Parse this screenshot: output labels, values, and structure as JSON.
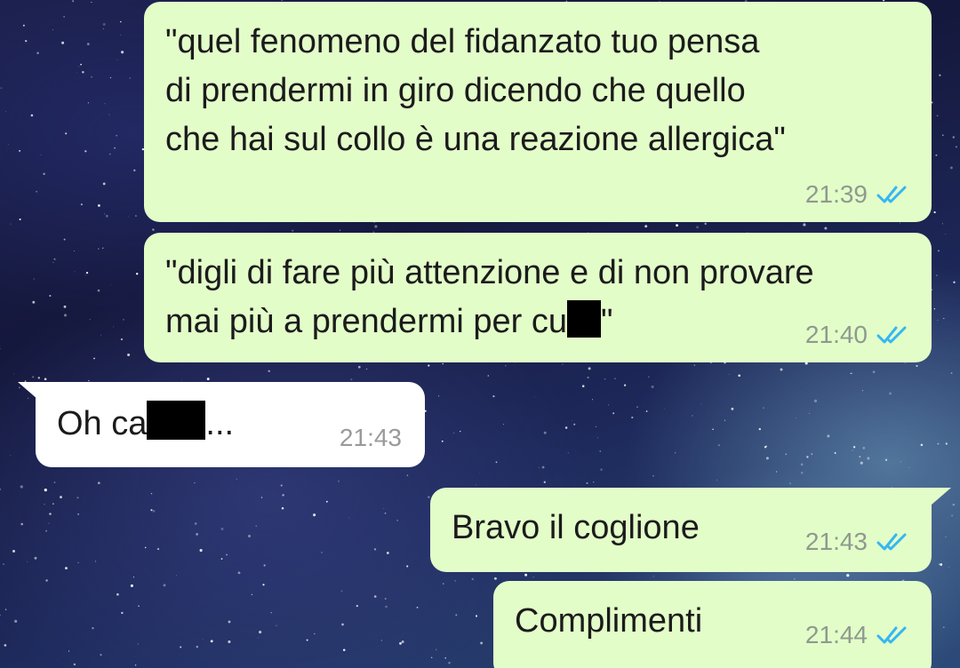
{
  "messages": [
    {
      "direction": "sent",
      "lines": [
        "\"quel fenomeno del fidanzato tuo pensa",
        "di prendermi in giro dicendo che quello",
        "che hai sul collo è una reazione allergica\""
      ],
      "time": "21:39",
      "status": "read"
    },
    {
      "direction": "sent",
      "lines": [
        "\"digli di fare più attenzione e di non provare",
        "mai più a prendermi per cu"
      ],
      "after_redaction": "\"",
      "time": "21:40",
      "status": "read"
    },
    {
      "direction": "received",
      "text_before": "Oh ca",
      "text_after": "...",
      "time": "21:43"
    },
    {
      "direction": "sent",
      "text": "Bravo il coglione",
      "time": "21:43",
      "status": "read"
    },
    {
      "direction": "sent",
      "text": "Complimenti",
      "time": "21:44",
      "status": "read"
    }
  ],
  "colors": {
    "sent_bubble": "#e3fdc9",
    "received_bubble": "#ffffff",
    "read_ticks": "#34b7f1",
    "timestamp": "#8e9a8e",
    "redaction": "#000000"
  },
  "icons": {
    "status": "double-check-icon"
  }
}
